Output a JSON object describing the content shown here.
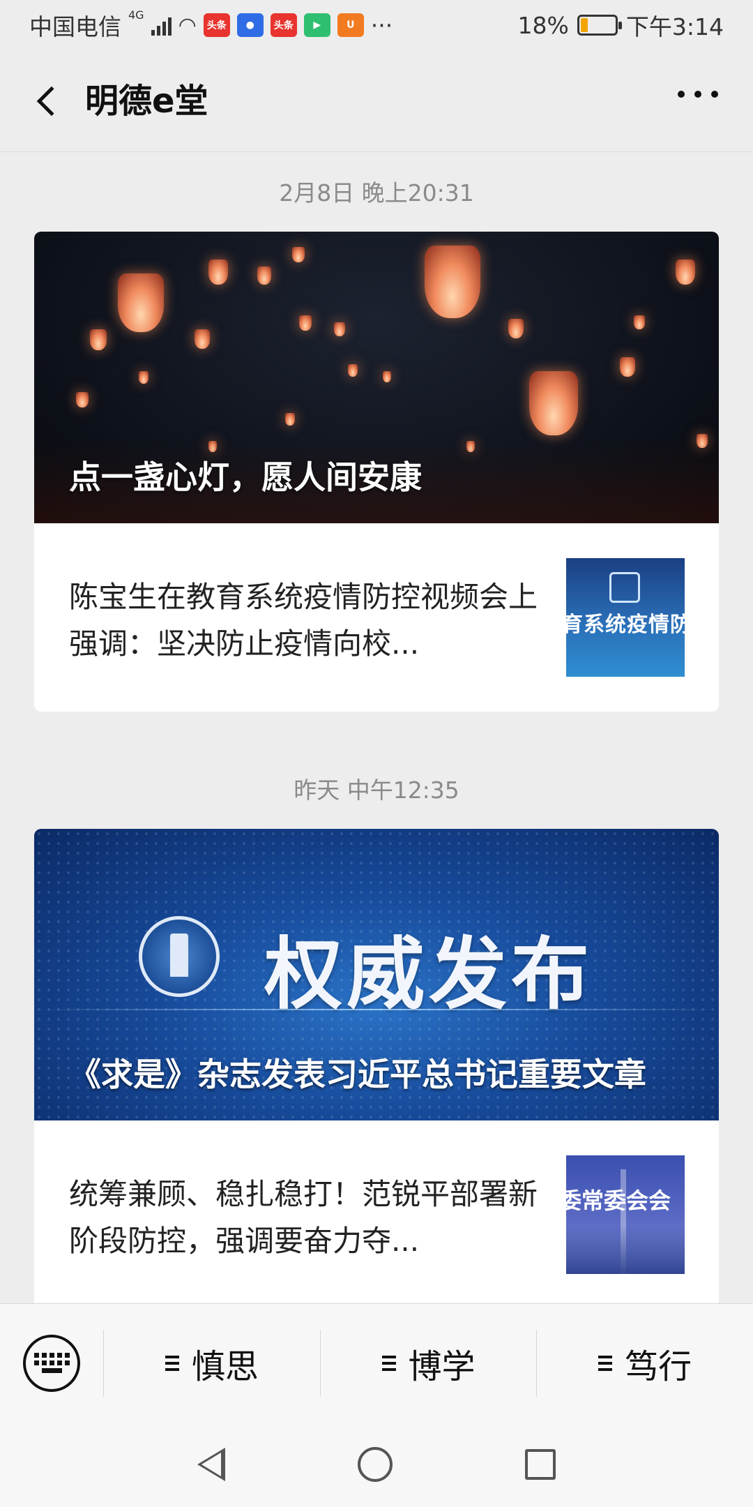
{
  "status_bar": {
    "carrier": "中国电信",
    "network": "4G",
    "battery": "18%",
    "time": "下午3:14",
    "app_icons": [
      "头条",
      "百度",
      "头条",
      "腾讯视频",
      "UC"
    ],
    "more": "···"
  },
  "header": {
    "title": "明德e堂"
  },
  "messages": [
    {
      "timestamp": "2月8日 晚上20:31",
      "hero_title": "点一盏心灯，愿人间安康",
      "sub_title": "陈宝生在教育系统疫情防控视频会上强调：坚决防止疫情向校...",
      "thumb_text": "育系统疫情防"
    },
    {
      "timestamp": "昨天 中午12:35",
      "hero_banner_text": "权威发布",
      "hero_title": "《求是》杂志发表习近平总书记重要文章",
      "sub_title": "统筹兼顾、稳扎稳打！范锐平部署新阶段防控，强调要奋力夺...",
      "thumb_text": "委常委会会"
    }
  ],
  "menu": {
    "items": [
      "慎思",
      "博学",
      "笃行"
    ]
  }
}
